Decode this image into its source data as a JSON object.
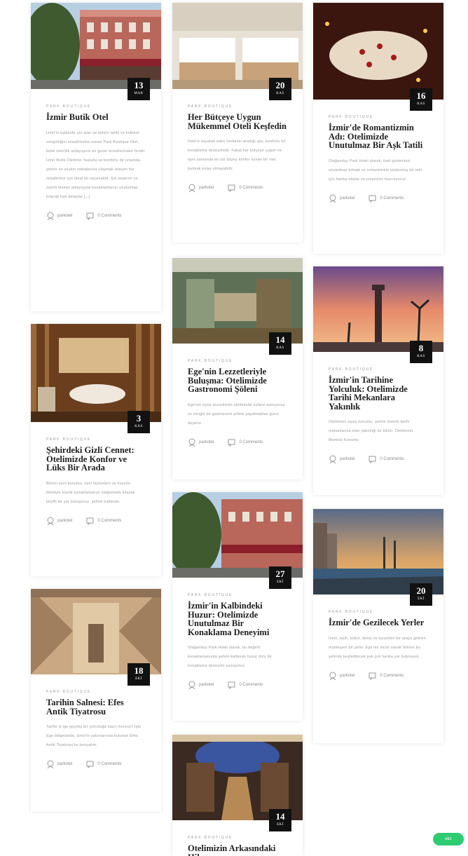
{
  "category_label": "PARK BOUTIQUE",
  "author": "parkotel",
  "comments_label": "0 Comments",
  "chat_label": "ekz",
  "colors": {
    "accent": "#111111",
    "chat": "#2ecc71"
  },
  "posts": [
    {
      "day": "13",
      "month": "MAR",
      "title": "İzmir Butik Otel",
      "excerpt": "İzmir'in kalbinde yer alan ve şehrin tarihi ve kültürel zenginliğini misafirlerine sunan Park Boutique Otel, butik otelcilik anlayışının en güzel örneklerinden biridir. İzmir Butik Otelimiz, huzurlu ve konforlu bir ortamda şehrin en seçkin noktalarına ulaşmak isteyen her misafirimiz için ideal bir seçenektir. Şık tasarımı ve özenli hizmet anlayışıyla konaklamanızı unutulmaz kılacak tüm detaylar [...]"
    },
    {
      "day": "20",
      "month": "KAS",
      "title": "Her Bütçeye Uygun Mükemmel Oteli Keşfedin",
      "excerpt": "İzmir'e seyahat eden herkesin aradığı şey, konforlu bir konaklama deneyimidir. Fakat her bütçeye uygun ve aynı zamanda en üst düzey konfor sunan bir otel bulmak kolay olmayabilir."
    },
    {
      "day": "16",
      "month": "KAS",
      "title": "İzmir'de Romantizmin Adı: Otelimizde Unutulmaz Bir Aşk Tatili",
      "excerpt": "Olağandışı Park Hotel olarak, özel günlerinizi unutulmaz kılmak ve romantizmle süslenmiş bir tatil için harika odalar ve sürprizler hazırlıyoruz."
    },
    {
      "day": "14",
      "month": "KAS",
      "title": "Ege'nin Lezzetleriyle Buluşma: Otelimizde Gastronomi Şöleni",
      "excerpt": "Ege'nin eşsiz lezzetlerini otelimizde sizlere sunuyoruz ve zengin bir gastronomi şöleni yaşatmaktan gurur duyarız."
    },
    {
      "day": "8",
      "month": "KAS",
      "title": "İzmir'in Tarihine Yolculuk: Otelimizde Tarihi Mekanlara Yakınlık",
      "excerpt": "Otelimizin eşsiz konumu, şehrin önemli tarihi mekanlarına olan yakınlığı ile bilinir. Otelimizin Merkezi Konumu"
    },
    {
      "day": "3",
      "month": "KAS",
      "title": "Şehirdeki Gizli Cennet: Otelimizde Konfor ve Lüks Bir Arada",
      "excerpt": "Birinci sınıf konumu, özel hizmetleri ve huzurlu iklimiyle büyük konaklamanızı olağanüstü kılacak keyifli bir yer sunuyoruz, şehrin kalbinde."
    },
    {
      "day": "27",
      "month": "EKİ",
      "title": "İzmir'in Kalbindeki Huzur: Otelimizde Unutulmaz Bir Konaklama Deneyimi",
      "excerpt": "Olağandışı Park Hotel olarak, bu değerli konaklamanızda şehrin kalbinde huzur dolu bir konaklama deneyimi sunuyoruz."
    },
    {
      "day": "20",
      "month": "EKİ",
      "title": "İzmir'de Gezilecek Yerler",
      "excerpt": "İzmir, tarih, kültür, deniz ve lezzetleri bir araya getiren muhteşem bir şehir. Ege'nin incisi olarak bilinen bu şehirde keşfedilecek pek çok harika yer bulunuyor."
    },
    {
      "day": "18",
      "month": "EKİ",
      "title": "Tarihin Salnesi: Efes Antik Tiyatrosu",
      "excerpt": "Tarihe iz ige geçmiş bir yolculuğa hazır mısınız? İşte Ege bölgesinde, İzmir'in yakınlarında bulunan Efes Antik Tiyatrosu'nu tanıyalım."
    },
    {
      "day": "14",
      "month": "EKİ",
      "title": "Otelimizin Arkasındaki Hikaye",
      "excerpt": ""
    }
  ]
}
